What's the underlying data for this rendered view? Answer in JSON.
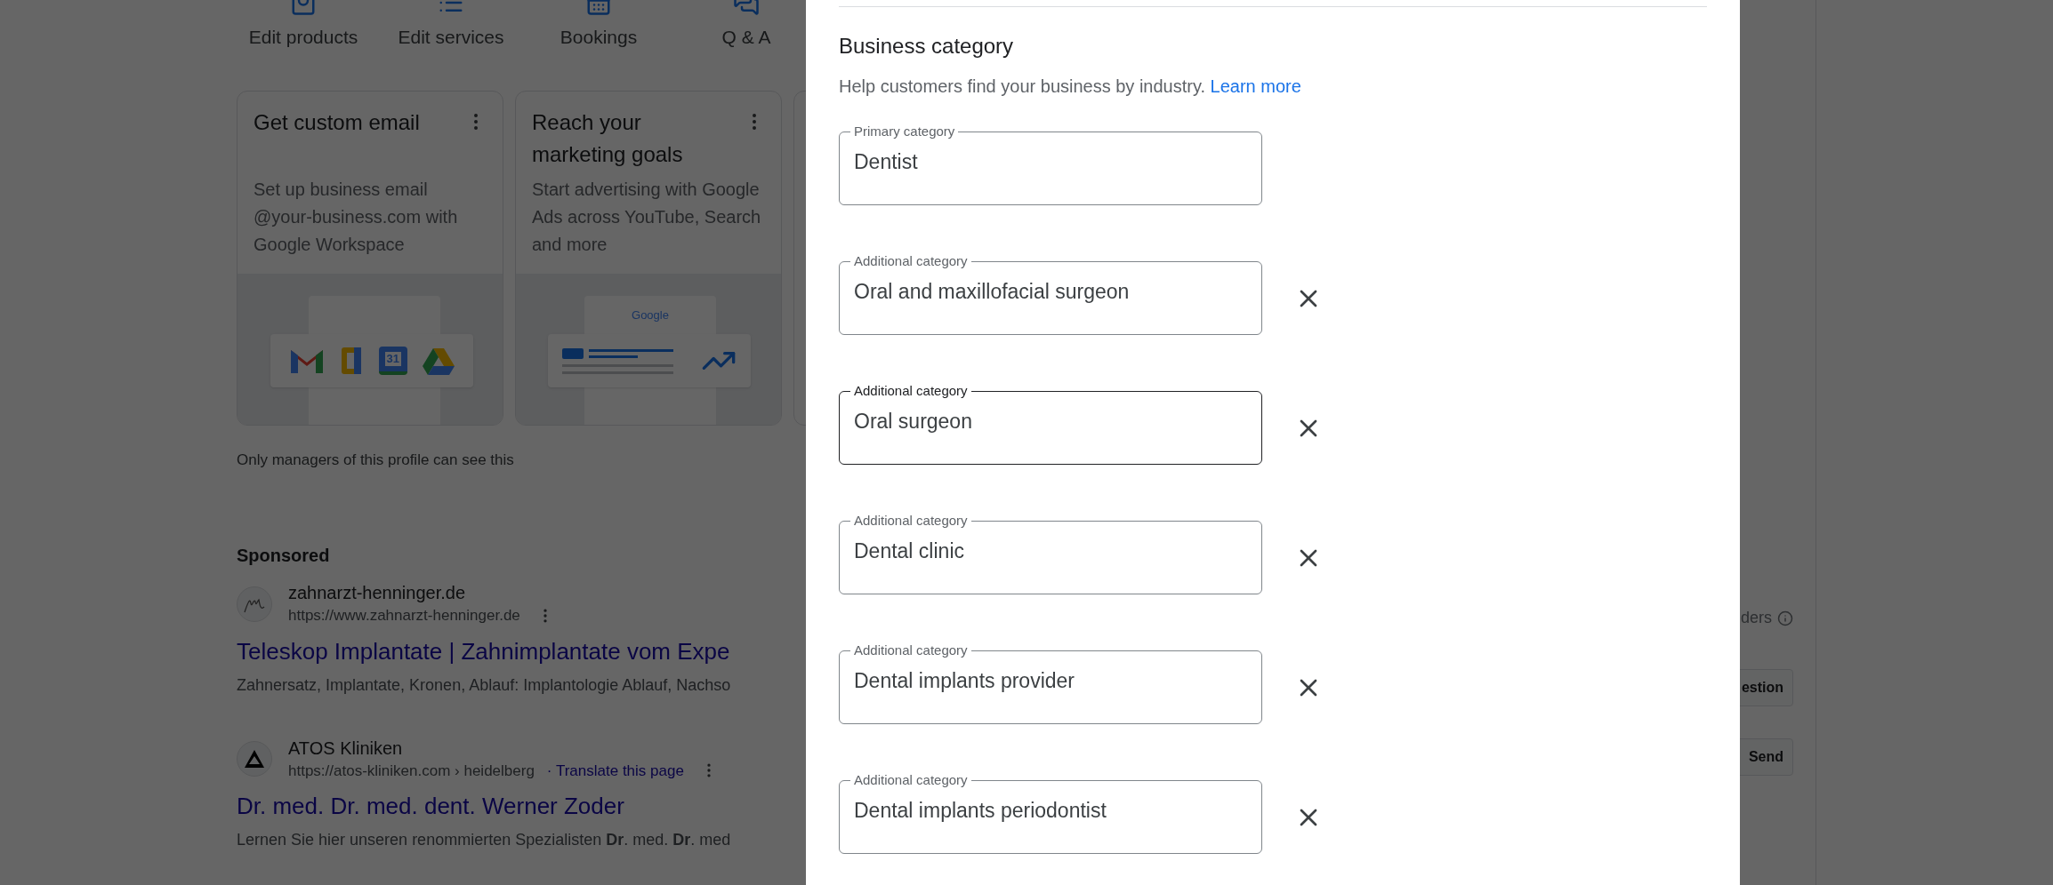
{
  "quick_actions": [
    {
      "label": "Edit products",
      "kind": "products"
    },
    {
      "label": "Edit services",
      "kind": "services"
    },
    {
      "label": "Bookings",
      "kind": "bookings"
    },
    {
      "label": "Q & A",
      "kind": "qa"
    }
  ],
  "promo_cards": [
    {
      "title": "Get custom email",
      "description": "Set up business email @your-business.com with Google Workspace",
      "kind": "workspace",
      "illustration_text": "31"
    },
    {
      "title": "Reach your marketing goals",
      "description": "Start advertising with Google Ads across YouTube, Search and more",
      "kind": "ads",
      "illustration_text": "Google"
    }
  ],
  "visibility_note": "Only managers of this profile can see this",
  "sponsored": {
    "heading": "Sponsored",
    "ads": [
      {
        "site": "zahnarzt-henninger.de",
        "url": "https://www.zahnarzt-henninger.de",
        "kind": "signature",
        "title": "Teleskop Implantate | Zahnimplantate vom Expe",
        "description": "Zahnersatz, Implantate, Kronen, Ablauf: Implantologie Ablauf, Nachso"
      },
      {
        "site": "ATOS Kliniken",
        "url": "https://atos-kliniken.com › heidelberg",
        "translate": "· Translate this page",
        "kind": "triangle",
        "title": "Dr. med. Dr. med. dent. Werner Zoder",
        "description": "Lernen Sie hier unseren renommierten Spezialisten **Dr**. med. **Dr**. med"
      }
    ]
  },
  "right_panel": {
    "note": "ders",
    "buttons": [
      "estion",
      "Send"
    ]
  },
  "dialog": {
    "section_title": "Business category",
    "help_text": "Help customers find your business by industry.",
    "learn_more": "Learn more",
    "categories": [
      {
        "label": "Primary category",
        "value": "Dentist",
        "removable": false,
        "focused": false
      },
      {
        "label": "Additional category",
        "value": "Oral and maxillofacial surgeon",
        "removable": true,
        "focused": false
      },
      {
        "label": "Additional category",
        "value": "Oral surgeon",
        "removable": true,
        "focused": true
      },
      {
        "label": "Additional category",
        "value": "Dental clinic",
        "removable": true,
        "focused": false
      },
      {
        "label": "Additional category",
        "value": "Dental implants provider",
        "removable": true,
        "focused": false
      },
      {
        "label": "Additional category",
        "value": "Dental implants periodontist",
        "removable": true,
        "focused": false
      }
    ]
  }
}
